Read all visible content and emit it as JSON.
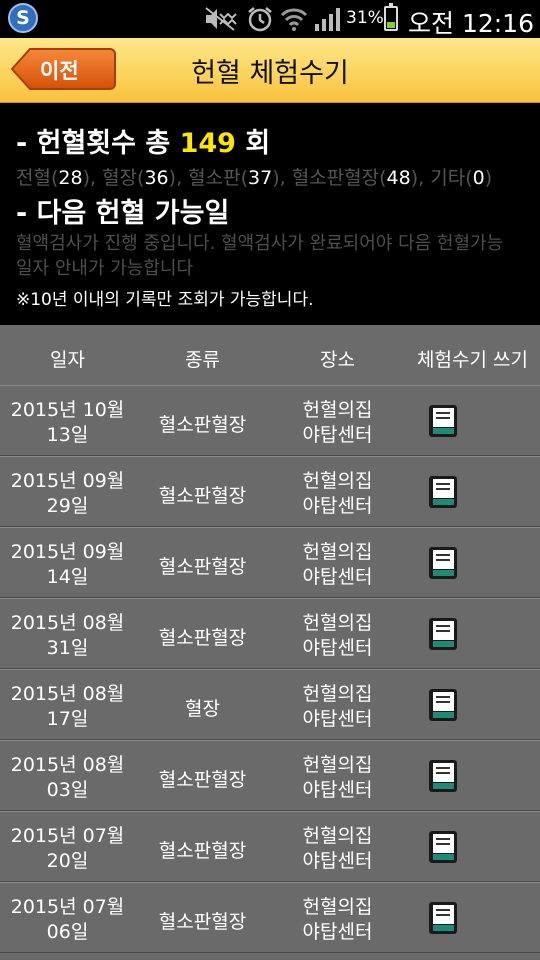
{
  "status_bar": {
    "battery_text": "31%",
    "time": "오전 12:16",
    "icons": [
      "app-s-icon",
      "mute-icon",
      "alarm-icon",
      "wifi-icon",
      "signal-icon",
      "battery-icon"
    ]
  },
  "header": {
    "back_label": "이전",
    "title": "헌혈 체험수기"
  },
  "summary": {
    "total_prefix": "- 헌혈횟수 총 ",
    "total_count": "149",
    "total_suffix": " 회",
    "breakdown": [
      {
        "label": "전혈",
        "count": "28"
      },
      {
        "label": "혈장",
        "count": "36"
      },
      {
        "label": "혈소판",
        "count": "37"
      },
      {
        "label": "혈소판혈장",
        "count": "48"
      },
      {
        "label": "기타",
        "count": "0"
      }
    ],
    "next_title": "- 다음 헌혈 가능일",
    "next_msg": "혈액검사가 진행 중입니다. 혈액검사가 완료되어야 다음 헌혈가능일자 안내가 가능합니다",
    "notice": "※10년 이내의 기록만 조회가 가능합니다."
  },
  "table": {
    "headers": {
      "date": "일자",
      "type": "종류",
      "place": "장소",
      "write": "체험수기 쓰기"
    },
    "rows": [
      {
        "date_l1": "2015년 10월",
        "date_l2": "13일",
        "type": "혈소판혈장",
        "place_l1": "헌혈의집",
        "place_l2": "야탑센터"
      },
      {
        "date_l1": "2015년 09월",
        "date_l2": "29일",
        "type": "혈소판혈장",
        "place_l1": "헌혈의집",
        "place_l2": "야탑센터"
      },
      {
        "date_l1": "2015년 09월",
        "date_l2": "14일",
        "type": "혈소판혈장",
        "place_l1": "헌혈의집",
        "place_l2": "야탑센터"
      },
      {
        "date_l1": "2015년 08월",
        "date_l2": "31일",
        "type": "혈소판혈장",
        "place_l1": "헌혈의집",
        "place_l2": "야탑센터"
      },
      {
        "date_l1": "2015년 08월",
        "date_l2": "17일",
        "type": "혈장",
        "place_l1": "헌혈의집",
        "place_l2": "야탑센터"
      },
      {
        "date_l1": "2015년 08월",
        "date_l2": "03일",
        "type": "혈소판혈장",
        "place_l1": "헌혈의집",
        "place_l2": "야탑센터"
      },
      {
        "date_l1": "2015년 07월",
        "date_l2": "20일",
        "type": "혈소판혈장",
        "place_l1": "헌혈의집",
        "place_l2": "야탑센터"
      },
      {
        "date_l1": "2015년 07월",
        "date_l2": "06일",
        "type": "혈소판혈장",
        "place_l1": "헌혈의집",
        "place_l2": "야탑센터"
      }
    ]
  },
  "colors": {
    "accent": "#ffe600",
    "header_bg": "#f8c23c",
    "back_button": "#e8620c"
  }
}
